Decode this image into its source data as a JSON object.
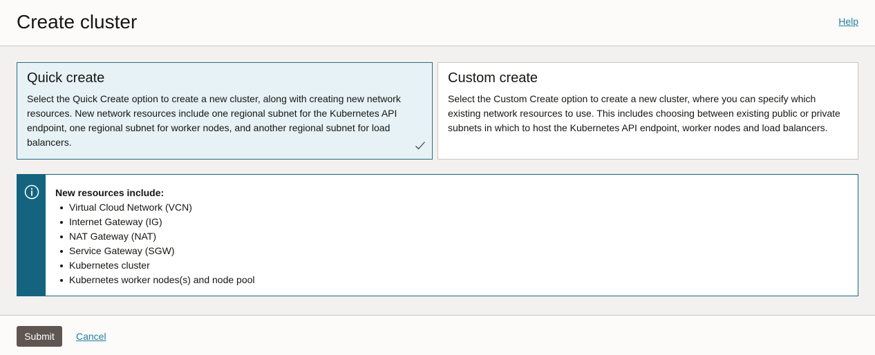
{
  "header": {
    "title": "Create cluster",
    "help_label": "Help"
  },
  "options": {
    "quick": {
      "title": "Quick create",
      "description": "Select the Quick Create option to create a new cluster, along with creating new network resources. New network resources include one regional subnet for the Kubernetes API endpoint, one regional subnet for worker nodes, and another regional subnet for load balancers.",
      "selected": true
    },
    "custom": {
      "title": "Custom create",
      "description": "Select the Custom Create option to create a new cluster, where you can specify which existing network resources to use. This includes choosing between existing public or private subnets in which to host the Kubernetes API endpoint, worker nodes and load balancers.",
      "selected": false
    }
  },
  "info": {
    "icon": "info-icon",
    "heading": "New resources include:",
    "items": [
      "Virtual Cloud Network (VCN)",
      "Internet Gateway (IG)",
      "NAT Gateway (NAT)",
      "Service Gateway (SGW)",
      "Kubernetes cluster",
      "Kubernetes worker nodes(s) and node pool"
    ]
  },
  "footer": {
    "submit_label": "Submit",
    "cancel_label": "Cancel"
  },
  "colors": {
    "accent": "#14647f",
    "selected_bg": "#e6f2f5",
    "link": "#227e9e",
    "submit_bg": "#5f5652"
  }
}
